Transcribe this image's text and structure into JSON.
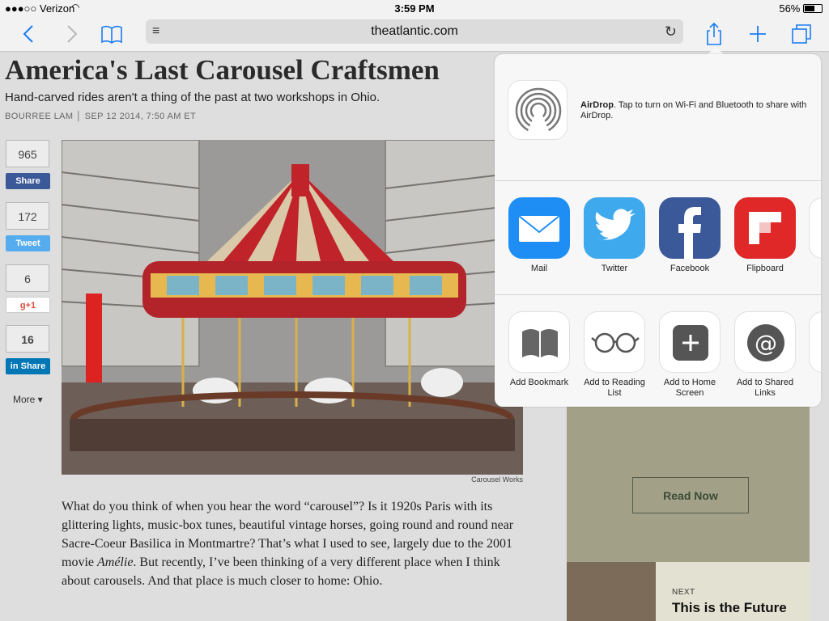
{
  "status": {
    "carrier": "●●●○○ Verizon",
    "time": "3:59 PM",
    "battery": "56%"
  },
  "toolbar": {
    "url": "theatlantic.com"
  },
  "article": {
    "title": "America's Last Carousel Craftsmen",
    "subtitle": "Hand-carved rides aren't a thing of the past at two workshops in Ohio.",
    "byline": "BOURREE LAM │ SEP 12 2014, 7:50 AM ET",
    "photo_caption": "Carousel Works",
    "body_p1": "What do you think of when you hear the word “carousel”? Is it 1920s Paris with its glittering lights, music-box tunes, beautiful vintage horses, going round and round near Sacre-Coeur Basilica in Montmartre? That’s what I used to see, largely due to the 2001 movie ",
    "body_em": "Amélie",
    "body_p2": ". But recently, I’ve been thinking of a very different place when I think about carousels. And that place is much closer to home: Ohio."
  },
  "social": {
    "facebook_count": "965",
    "facebook_label": "Share",
    "twitter_count": "172",
    "twitter_label": "Tweet",
    "gplus_count": "6",
    "gplus_label": "g+1",
    "linkedin_count": "16",
    "linkedin_label": "in  Share",
    "more_label": "More ▾"
  },
  "sidebar": {
    "read_now": "Read Now",
    "next_label": "NEXT",
    "next_title": "This is the Future"
  },
  "share_sheet": {
    "airdrop_bold": "AirDrop",
    "airdrop_text": ". Tap to turn on Wi-Fi and Bluetooth to share with AirDrop.",
    "apps": [
      "Mail",
      "Twitter",
      "Facebook",
      "Flipboard"
    ],
    "actions": [
      "Add Bookmark",
      "Add to Reading List",
      "Add to Home Screen",
      "Add to Shared Links"
    ]
  },
  "colors": {
    "accent": "#1a7cf6",
    "facebook": "#3b5998",
    "twitter": "#55acee",
    "gplus": "#dd4b39",
    "linkedin": "#0077b5",
    "flipboard": "#e12828"
  }
}
